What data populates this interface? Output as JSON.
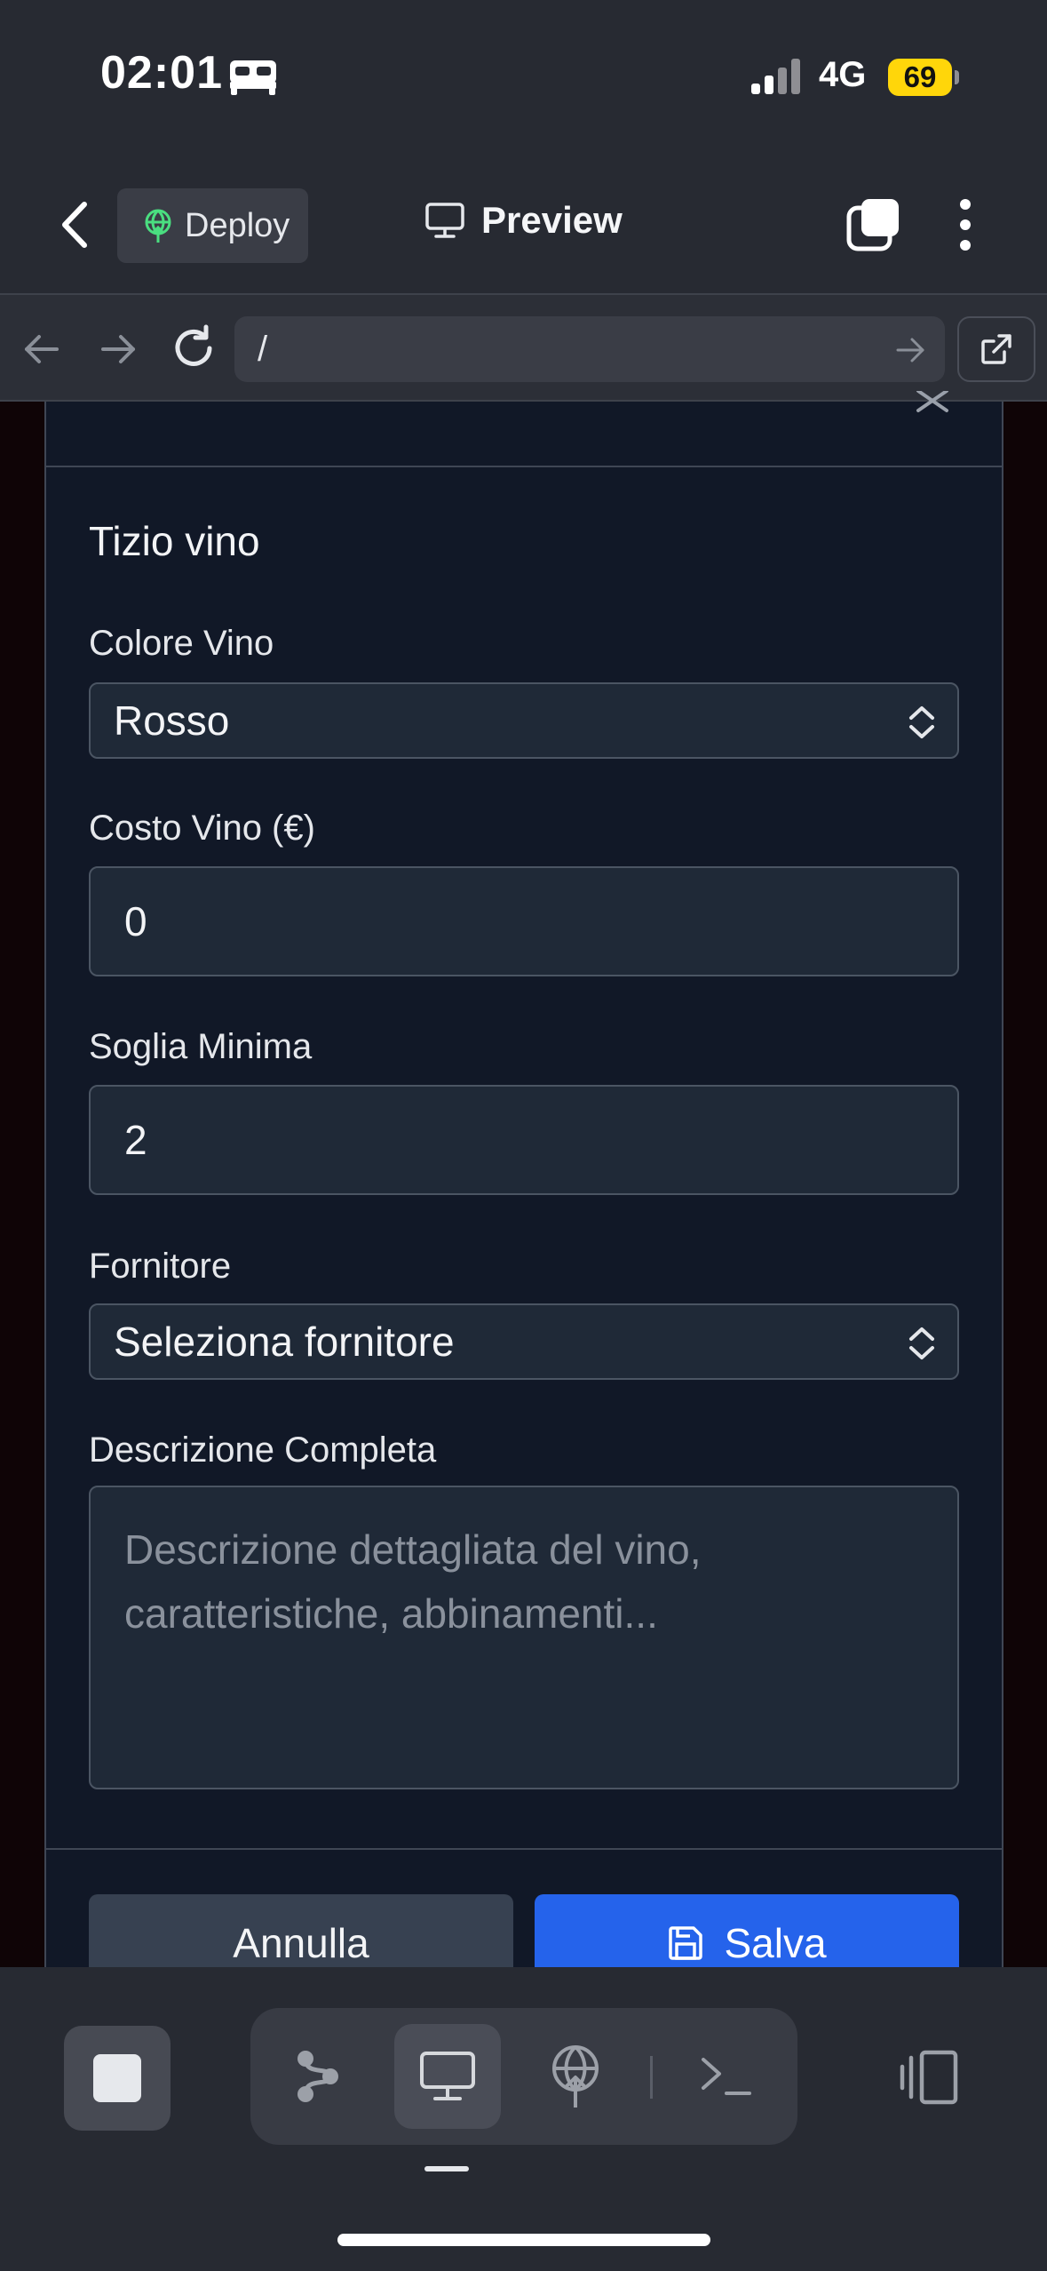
{
  "status_bar": {
    "time": "02:01",
    "network": "4G",
    "battery": "69"
  },
  "header": {
    "deploy_label": "Deploy",
    "preview_label": "Preview"
  },
  "browser": {
    "url": "/"
  },
  "form": {
    "title": "Tizio vino",
    "colore_label": "Colore Vino",
    "colore_value": "Rosso",
    "costo_label": "Costo Vino (€)",
    "costo_value": "0",
    "soglia_label": "Soglia Minima",
    "soglia_value": "2",
    "fornitore_label": "Fornitore",
    "fornitore_value": "Seleziona fornitore",
    "descrizione_label": "Descrizione Completa",
    "descrizione_placeholder": "Descrizione dettagliata del vino,\ncaratteristiche, abbinamenti...",
    "cancel_label": "Annulla",
    "save_label": "Salva"
  },
  "colors": {
    "primary": "#2563eb",
    "battery": "#ffd60a",
    "deploy_icon": "#4ade80"
  },
  "icons": [
    "bed-icon",
    "signal-icon",
    "back-icon",
    "deploy-icon",
    "monitor-icon",
    "tabs-icon",
    "more-icon",
    "arrow-left-icon",
    "arrow-right-icon",
    "reload-icon",
    "external-link-icon",
    "close-icon",
    "chevrons-icon",
    "save-icon",
    "stop-icon",
    "git-branch-icon",
    "deploy-globe-icon",
    "terminal-icon",
    "panel-icon"
  ]
}
